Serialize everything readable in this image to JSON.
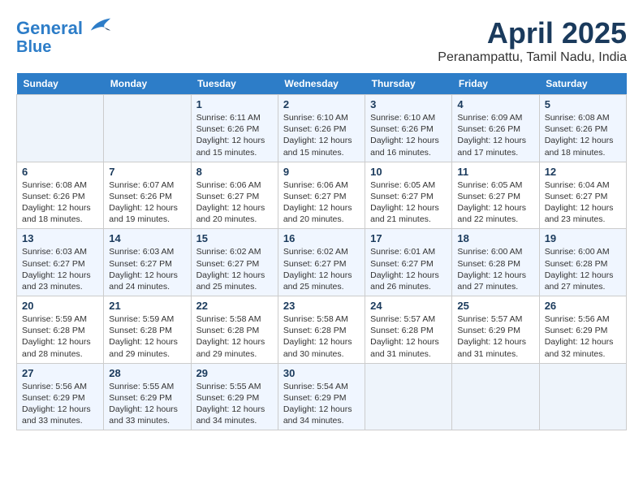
{
  "header": {
    "logo_line1": "General",
    "logo_line2": "Blue",
    "month_title": "April 2025",
    "location": "Peranampattu, Tamil Nadu, India"
  },
  "weekdays": [
    "Sunday",
    "Monday",
    "Tuesday",
    "Wednesday",
    "Thursday",
    "Friday",
    "Saturday"
  ],
  "weeks": [
    [
      {
        "day": "",
        "info": ""
      },
      {
        "day": "",
        "info": ""
      },
      {
        "day": "1",
        "info": "Sunrise: 6:11 AM\nSunset: 6:26 PM\nDaylight: 12 hours and 15 minutes."
      },
      {
        "day": "2",
        "info": "Sunrise: 6:10 AM\nSunset: 6:26 PM\nDaylight: 12 hours and 15 minutes."
      },
      {
        "day": "3",
        "info": "Sunrise: 6:10 AM\nSunset: 6:26 PM\nDaylight: 12 hours and 16 minutes."
      },
      {
        "day": "4",
        "info": "Sunrise: 6:09 AM\nSunset: 6:26 PM\nDaylight: 12 hours and 17 minutes."
      },
      {
        "day": "5",
        "info": "Sunrise: 6:08 AM\nSunset: 6:26 PM\nDaylight: 12 hours and 18 minutes."
      }
    ],
    [
      {
        "day": "6",
        "info": "Sunrise: 6:08 AM\nSunset: 6:26 PM\nDaylight: 12 hours and 18 minutes."
      },
      {
        "day": "7",
        "info": "Sunrise: 6:07 AM\nSunset: 6:26 PM\nDaylight: 12 hours and 19 minutes."
      },
      {
        "day": "8",
        "info": "Sunrise: 6:06 AM\nSunset: 6:27 PM\nDaylight: 12 hours and 20 minutes."
      },
      {
        "day": "9",
        "info": "Sunrise: 6:06 AM\nSunset: 6:27 PM\nDaylight: 12 hours and 20 minutes."
      },
      {
        "day": "10",
        "info": "Sunrise: 6:05 AM\nSunset: 6:27 PM\nDaylight: 12 hours and 21 minutes."
      },
      {
        "day": "11",
        "info": "Sunrise: 6:05 AM\nSunset: 6:27 PM\nDaylight: 12 hours and 22 minutes."
      },
      {
        "day": "12",
        "info": "Sunrise: 6:04 AM\nSunset: 6:27 PM\nDaylight: 12 hours and 23 minutes."
      }
    ],
    [
      {
        "day": "13",
        "info": "Sunrise: 6:03 AM\nSunset: 6:27 PM\nDaylight: 12 hours and 23 minutes."
      },
      {
        "day": "14",
        "info": "Sunrise: 6:03 AM\nSunset: 6:27 PM\nDaylight: 12 hours and 24 minutes."
      },
      {
        "day": "15",
        "info": "Sunrise: 6:02 AM\nSunset: 6:27 PM\nDaylight: 12 hours and 25 minutes."
      },
      {
        "day": "16",
        "info": "Sunrise: 6:02 AM\nSunset: 6:27 PM\nDaylight: 12 hours and 25 minutes."
      },
      {
        "day": "17",
        "info": "Sunrise: 6:01 AM\nSunset: 6:27 PM\nDaylight: 12 hours and 26 minutes."
      },
      {
        "day": "18",
        "info": "Sunrise: 6:00 AM\nSunset: 6:28 PM\nDaylight: 12 hours and 27 minutes."
      },
      {
        "day": "19",
        "info": "Sunrise: 6:00 AM\nSunset: 6:28 PM\nDaylight: 12 hours and 27 minutes."
      }
    ],
    [
      {
        "day": "20",
        "info": "Sunrise: 5:59 AM\nSunset: 6:28 PM\nDaylight: 12 hours and 28 minutes."
      },
      {
        "day": "21",
        "info": "Sunrise: 5:59 AM\nSunset: 6:28 PM\nDaylight: 12 hours and 29 minutes."
      },
      {
        "day": "22",
        "info": "Sunrise: 5:58 AM\nSunset: 6:28 PM\nDaylight: 12 hours and 29 minutes."
      },
      {
        "day": "23",
        "info": "Sunrise: 5:58 AM\nSunset: 6:28 PM\nDaylight: 12 hours and 30 minutes."
      },
      {
        "day": "24",
        "info": "Sunrise: 5:57 AM\nSunset: 6:28 PM\nDaylight: 12 hours and 31 minutes."
      },
      {
        "day": "25",
        "info": "Sunrise: 5:57 AM\nSunset: 6:29 PM\nDaylight: 12 hours and 31 minutes."
      },
      {
        "day": "26",
        "info": "Sunrise: 5:56 AM\nSunset: 6:29 PM\nDaylight: 12 hours and 32 minutes."
      }
    ],
    [
      {
        "day": "27",
        "info": "Sunrise: 5:56 AM\nSunset: 6:29 PM\nDaylight: 12 hours and 33 minutes."
      },
      {
        "day": "28",
        "info": "Sunrise: 5:55 AM\nSunset: 6:29 PM\nDaylight: 12 hours and 33 minutes."
      },
      {
        "day": "29",
        "info": "Sunrise: 5:55 AM\nSunset: 6:29 PM\nDaylight: 12 hours and 34 minutes."
      },
      {
        "day": "30",
        "info": "Sunrise: 5:54 AM\nSunset: 6:29 PM\nDaylight: 12 hours and 34 minutes."
      },
      {
        "day": "",
        "info": ""
      },
      {
        "day": "",
        "info": ""
      },
      {
        "day": "",
        "info": ""
      }
    ]
  ]
}
